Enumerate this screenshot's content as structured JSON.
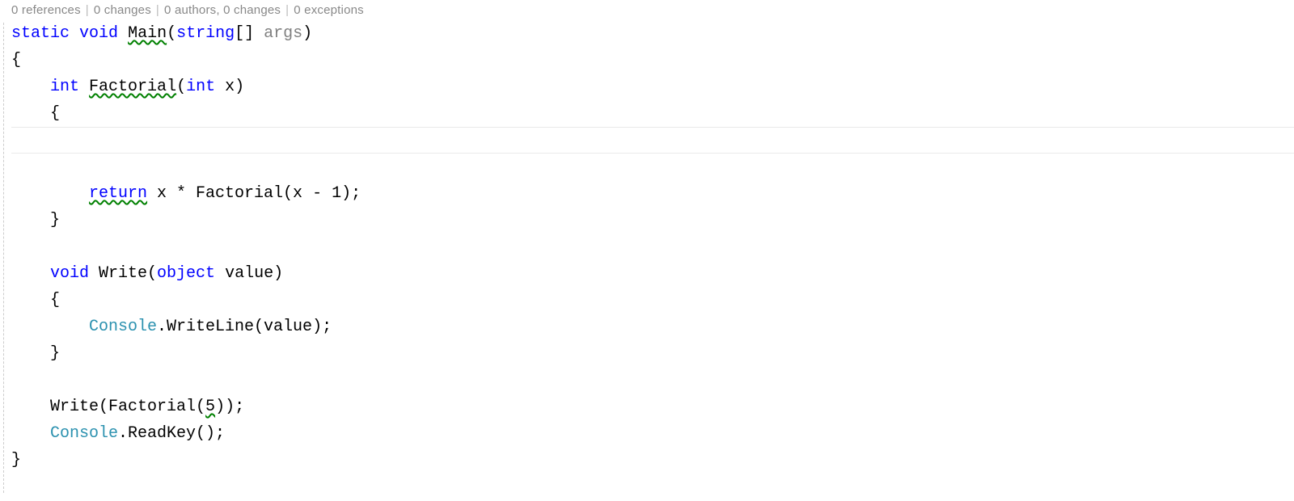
{
  "codelens": {
    "references": "0 references",
    "changes1": "0 changes",
    "authors": "0 authors, 0 changes",
    "exceptions": "0 exceptions"
  },
  "code": {
    "l1": {
      "static": "static",
      "void": "void",
      "main": "Main",
      "paren_open": "(",
      "string": "string",
      "brackets": "[]",
      "sp": " ",
      "args": "args",
      "paren_close": ")"
    },
    "l2": "{",
    "l3": {
      "indent": "    ",
      "int": "int",
      "sp": " ",
      "factorial": "Factorial",
      "paren_open": "(",
      "int2": "int",
      "x": " x",
      "paren_close": ")"
    },
    "l4": "    {",
    "l5": "",
    "l6": "",
    "l7": {
      "indent": "        ",
      "return": "return",
      "rest": " x * Factorial(x - 1);"
    },
    "l8": "    }",
    "l9": "",
    "l10": {
      "indent": "    ",
      "void": "void",
      "write": " Write(",
      "object": "object",
      "value": " value)"
    },
    "l11": "    {",
    "l12": {
      "indent": "        ",
      "console": "Console",
      "rest": ".WriteLine(value);"
    },
    "l13": "    }",
    "l14": "",
    "l15": {
      "indent": "    ",
      "text1": "Write(Factorial(",
      "five": "5",
      "text2": "));"
    },
    "l16": {
      "indent": "    ",
      "console": "Console",
      "rest": ".ReadKey();"
    },
    "l17": "}"
  }
}
